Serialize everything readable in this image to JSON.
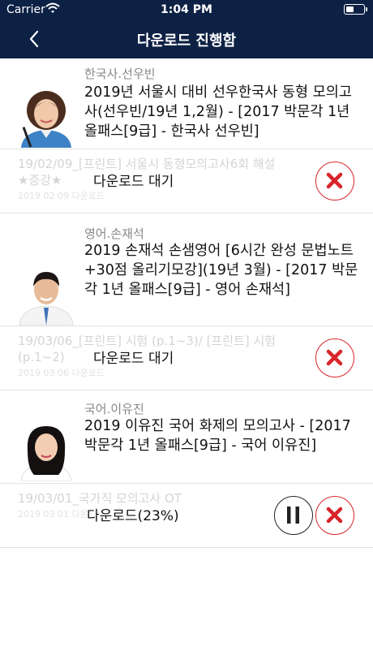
{
  "status_bar": {
    "carrier": "Carrier",
    "time": "1:04 PM"
  },
  "nav": {
    "title": "다운로드 진행함"
  },
  "colors": {
    "nav_bg": "#0d2145",
    "cancel_red": "#d8252a"
  },
  "items": [
    {
      "teacher": "한국사.선우빈",
      "title": "2019년 서울시 대비 선우한국사 동형 모의고사(선우빈/19년 1,2월) - [2017 박문각 1년 올패스[9급] - 한국사 선우빈]",
      "bg_line1": "19/02/09_[프린트] 서울시 동형모의고사6회 해설",
      "bg_line2": "★증강★",
      "bg_line3": "2019 02 09 다운로드",
      "status": "다운로드 대기"
    },
    {
      "teacher": "영어.손재석",
      "title": "2019 손재석 손샘영어 [6시간 완성 문법노트+30점 올리기모강](19년 3월) - [2017 박문각 1년 올패스[9급] - 영어 손재석]",
      "bg_line1": "19/03/06_[프린트] 시험 (p.1~3)/ [프린트] 시험",
      "bg_line2": "(p.1~2)",
      "bg_line3": "2019 03 06 다운로드",
      "status": "다운로드 대기"
    },
    {
      "teacher": "국어.이유진",
      "title": "2019 이유진 국어 화제의 모의고사 - [2017 박문각 1년 올패스[9급] - 국어 이유진]",
      "bg_line1": "19/03/01_국가직 모의고사 OT",
      "bg_line2": "",
      "bg_line3": "2019 03 01 다운로드",
      "status": "다운로드(23%)",
      "progress": 0.23
    }
  ]
}
